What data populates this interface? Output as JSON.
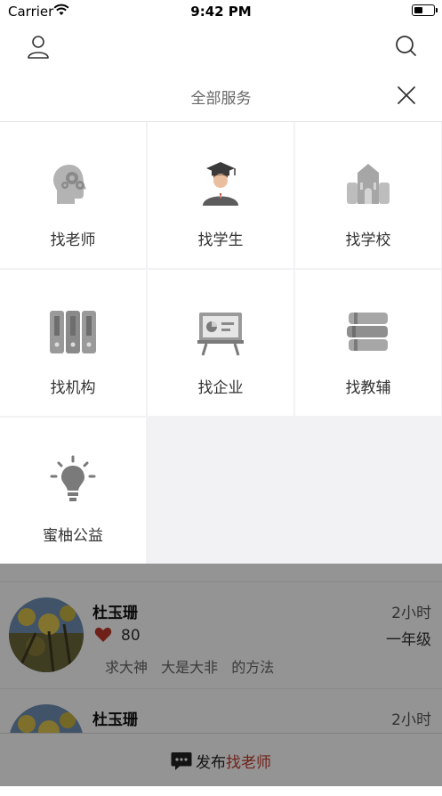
{
  "status_bar": {
    "carrier": "Carrier",
    "time": "9:42 PM"
  },
  "panel": {
    "title": "全部服务"
  },
  "services": [
    {
      "label": "找老师",
      "icon": "head-gears-icon"
    },
    {
      "label": "找学生",
      "icon": "graduate-icon"
    },
    {
      "label": "找学校",
      "icon": "school-building-icon"
    },
    {
      "label": "找机构",
      "icon": "binders-icon"
    },
    {
      "label": "找企业",
      "icon": "presentation-board-icon"
    },
    {
      "label": "找教辅",
      "icon": "books-icon"
    },
    {
      "label": "蜜柚公益",
      "icon": "lightbulb-icon"
    }
  ],
  "feed": [
    {
      "name": "杜玉珊",
      "time": "2小时",
      "likes": "80",
      "grade": "一年级",
      "tags": [
        "求大神",
        "大是大非",
        "的方法"
      ]
    },
    {
      "name": "杜玉珊",
      "time": "2小时"
    }
  ],
  "publish": {
    "prefix": "发布",
    "accent": "找老师"
  },
  "colors": {
    "accent": "#c0392b",
    "icon_gray": "#8a8a8a",
    "heart": "#c0392b"
  }
}
